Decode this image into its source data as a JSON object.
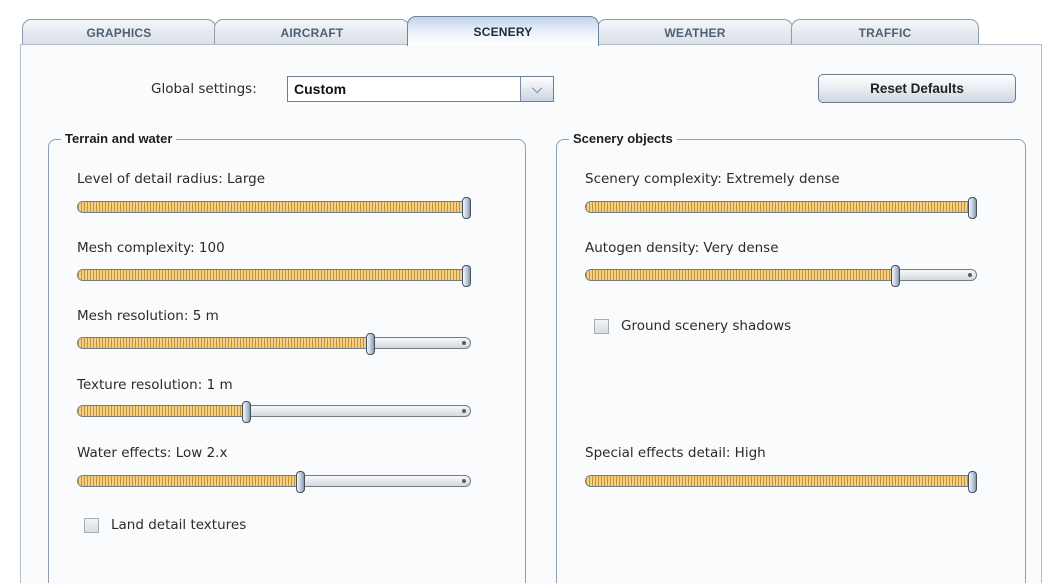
{
  "tabs": [
    {
      "label": "GRAPHICS"
    },
    {
      "label": "AIRCRAFT"
    },
    {
      "label": "SCENERY"
    },
    {
      "label": "WEATHER"
    },
    {
      "label": "TRAFFIC"
    }
  ],
  "active_tab": "SCENERY",
  "global_settings": {
    "label": "Global settings:",
    "value": "Custom"
  },
  "reset_label": "Reset Defaults",
  "terrain": {
    "title": "Terrain and water",
    "sliders": [
      {
        "label": "Level of detail radius: Large",
        "level": 1.0
      },
      {
        "label": "Mesh complexity: 100",
        "level": 1.0
      },
      {
        "label": "Mesh resolution: 5 m",
        "level": 0.75
      },
      {
        "label": "Texture resolution: 1 m",
        "level": 0.43
      },
      {
        "label": "Water effects: Low 2.x",
        "level": 0.57
      }
    ],
    "checkbox": {
      "label": "Land detail textures",
      "checked": false
    }
  },
  "scenery_objects": {
    "title": "Scenery objects",
    "sliders": [
      {
        "label": "Scenery complexity: Extremely dense",
        "level": 1.0
      },
      {
        "label": "Autogen density: Very dense",
        "level": 0.8
      },
      {
        "label": "Special effects detail: High",
        "level": 1.0
      }
    ],
    "checkbox": {
      "label": "Ground scenery shadows",
      "checked": false
    }
  },
  "colors": {
    "fill": "#d9a441",
    "tab_active": "#eef3fa",
    "border": "#8fa0b4"
  },
  "icons": {
    "dropdown": "chevron-down-icon"
  }
}
